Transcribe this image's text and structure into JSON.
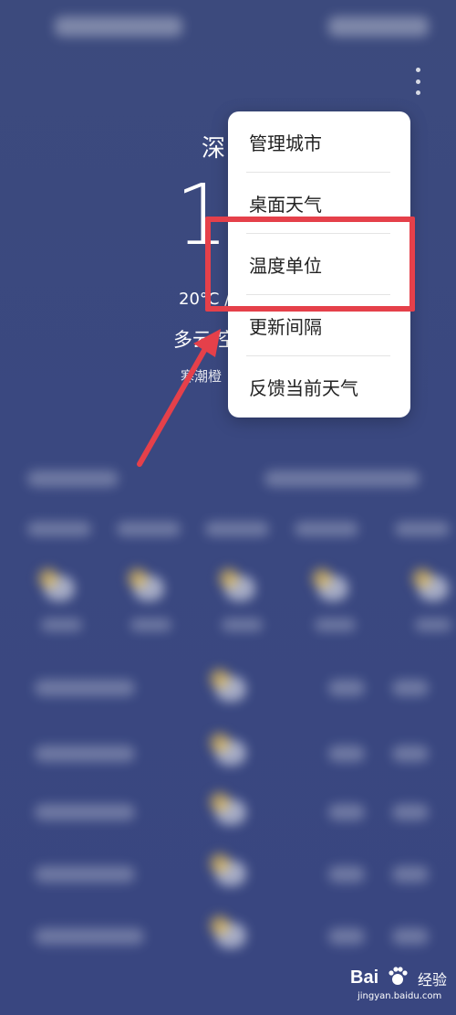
{
  "weather": {
    "city": "深",
    "temperature": "1",
    "range": "20°C /",
    "condition": "多云  空",
    "subtitle": "寒潮橙"
  },
  "menu": {
    "items": [
      {
        "label": "管理城市"
      },
      {
        "label": "桌面天气"
      },
      {
        "label": "温度单位"
      },
      {
        "label": "更新间隔"
      },
      {
        "label": "反馈当前天气"
      }
    ]
  },
  "watermark": {
    "brand": "Bai",
    "brand2": "经验",
    "url": "jingyan.baidu.com"
  },
  "colors": {
    "background": "#3a4880",
    "highlight": "#e5404a",
    "menu_bg": "#ffffff"
  },
  "icons": [
    "more-vertical-icon",
    "partly-cloudy-icon",
    "arrow-annotation-icon",
    "paw-icon"
  ]
}
